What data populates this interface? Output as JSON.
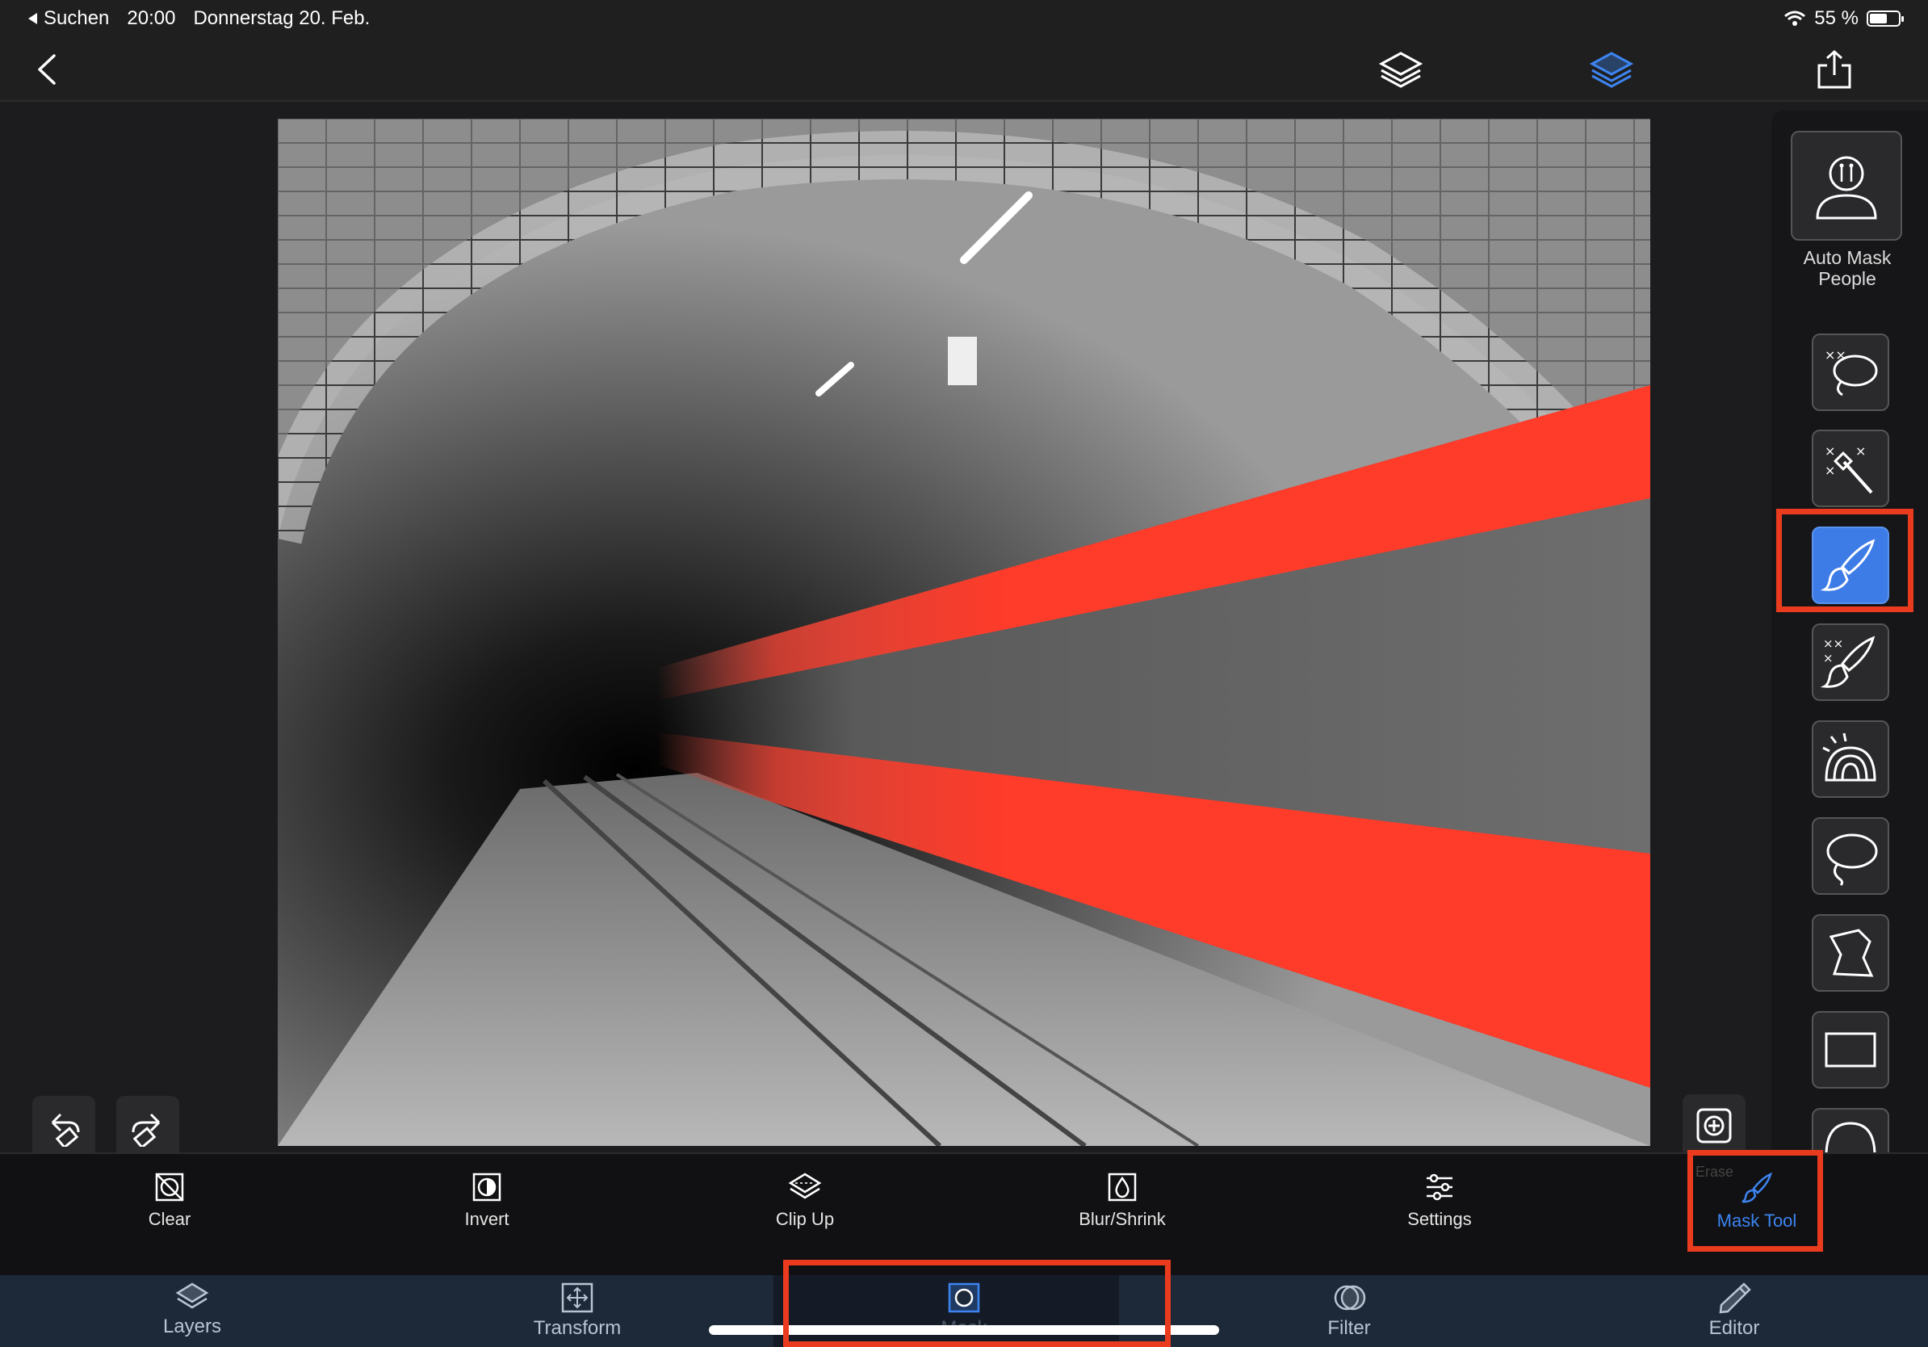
{
  "statusbar": {
    "back_app": "Suchen",
    "time": "20:00",
    "date": "Donnerstag 20. Feb.",
    "battery": "55 %",
    "battery_level": 0.55
  },
  "navbar": {
    "icons": [
      "back-chevron-icon",
      "layers-icon",
      "layers-active-icon",
      "share-icon"
    ]
  },
  "side_panel": {
    "auto_mask_label_1": "Auto Mask",
    "auto_mask_label_2": "People",
    "tools": [
      "auto-lasso-icon",
      "magic-wand-icon",
      "brush-icon",
      "smart-brush-icon",
      "gradient-icon",
      "lasso-icon",
      "polygon-icon",
      "rectangle-icon",
      "ellipse-icon"
    ],
    "active_tool": "brush-icon"
  },
  "toolbar": {
    "clear": "Clear",
    "invert": "Invert",
    "clip_up": "Clip Up",
    "blur_shrink": "Blur/Shrink",
    "settings": "Settings",
    "erase": "Erase",
    "mask_tool": "Mask Tool"
  },
  "tabbar": {
    "layers": "Layers",
    "transform": "Transform",
    "mask": "Mask",
    "filter": "Filter",
    "editor": "Editor"
  },
  "colors": {
    "accent": "#3d7be6",
    "highlight": "#ea3b1e",
    "train_red": "#ff3b2a"
  }
}
